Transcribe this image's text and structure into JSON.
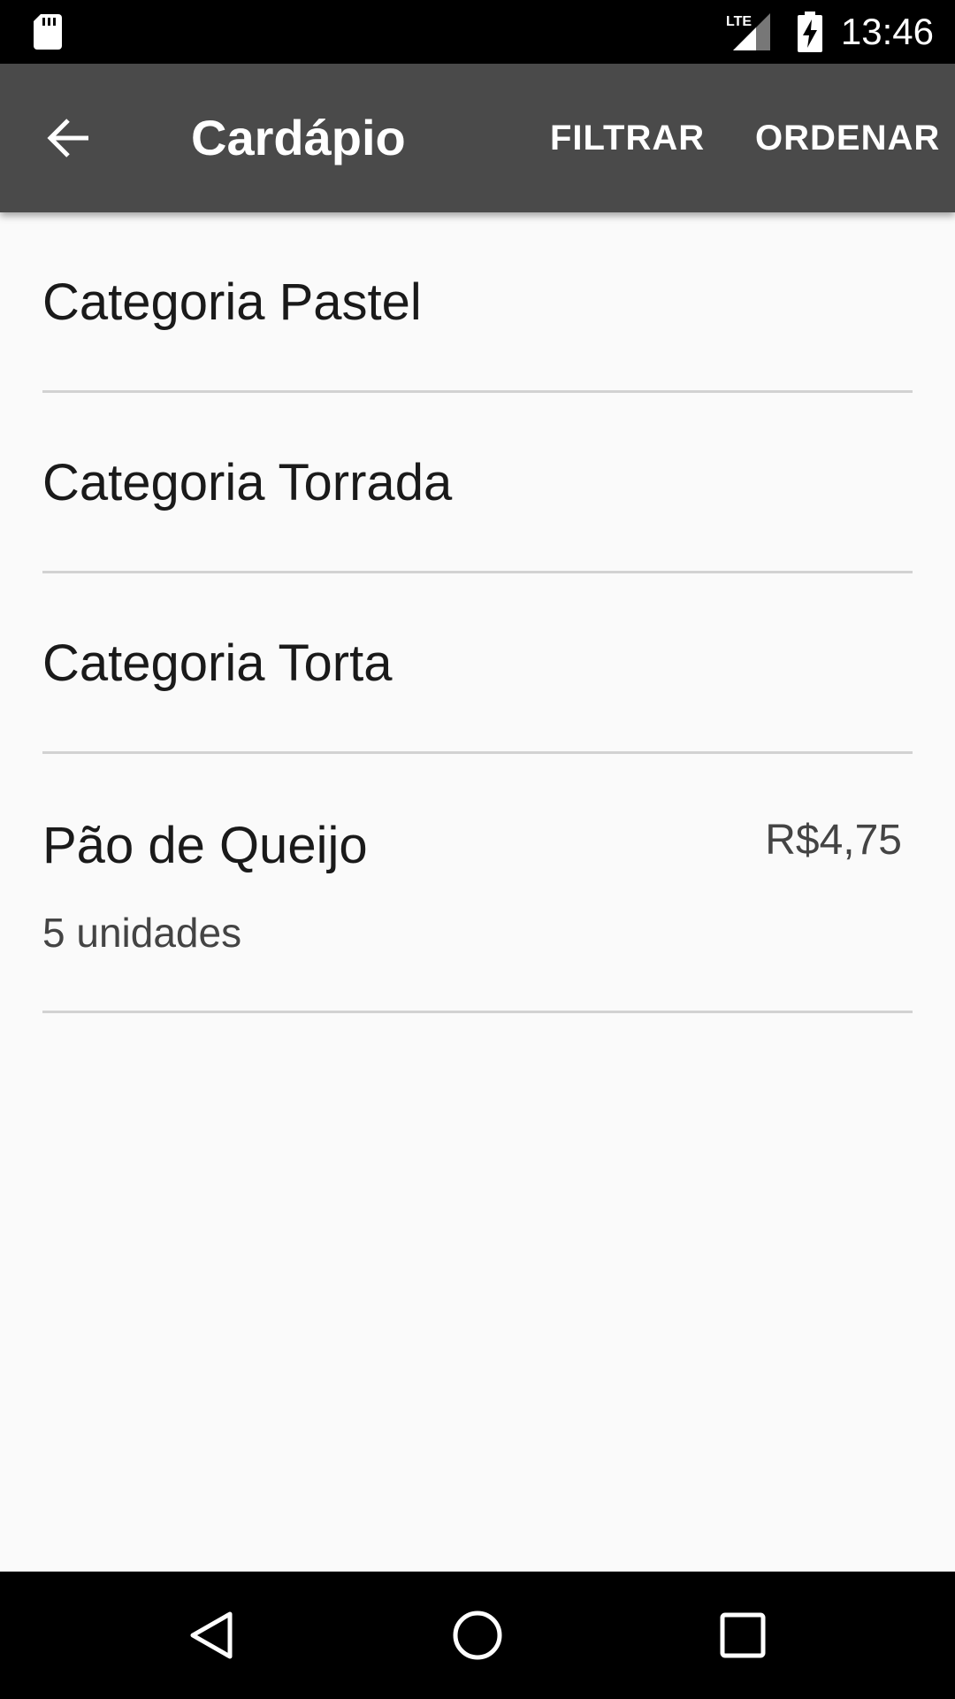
{
  "status_bar": {
    "network_label": "LTE",
    "time": "13:46"
  },
  "app_bar": {
    "title": "Cardápio",
    "actions": [
      "FILTRAR",
      "ORDENAR"
    ]
  },
  "list": {
    "categories": [
      {
        "label": "Categoria Pastel"
      },
      {
        "label": "Categoria Torrada"
      },
      {
        "label": "Categoria Torta"
      }
    ],
    "products": [
      {
        "name": "Pão de Queijo",
        "description": "5 unidades",
        "price": "R$4,75"
      }
    ]
  },
  "icons": {
    "sd_card": "sd-card-icon",
    "signal": "signal-icon",
    "battery": "battery-charging-icon",
    "back": "arrow-back-icon",
    "nav_back": "triangle-back-icon",
    "nav_home": "circle-home-icon",
    "nav_recents": "square-recents-icon"
  },
  "colors": {
    "app_bar": "#4a4a4a",
    "background": "#fafafa",
    "divider": "#d2d2d2",
    "system_bars": "#000000"
  }
}
